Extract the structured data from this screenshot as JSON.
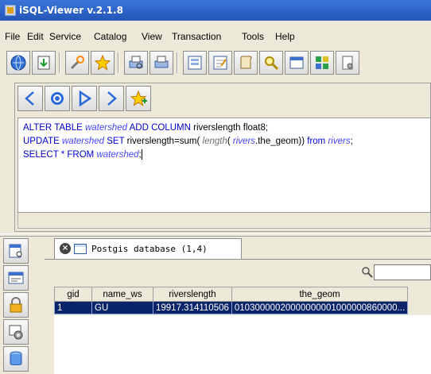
{
  "window": {
    "title": "iSQL-Viewer v.2.1.8"
  },
  "menu": [
    "File",
    "Edit",
    "Service",
    "Catalog",
    "View",
    "Transaction",
    "Tools",
    "Help"
  ],
  "editor": {
    "line1": {
      "k1": "ALTER TABLE ",
      "t1": "watershed",
      "k2": " ADD COLUMN ",
      "x1": "riverslength float8;"
    },
    "line2": {
      "k1": "UPDATE ",
      "t1": "watershed",
      "k2": " SET ",
      "x1": "riverslength=sum( ",
      "f1": "length",
      "x2": "( ",
      "t2": "rivers",
      "x3": ".the_geom)) ",
      "k3": "from ",
      "t3": "rivers",
      "x4": ";"
    },
    "line3": {
      "k1": "SELECT * FROM ",
      "t1": "watershed",
      "x1": ";"
    }
  },
  "results": {
    "tab_label": "Postgis database (1,4)",
    "tab_close": "×",
    "search_value": "",
    "columns": [
      "gid",
      "name_ws",
      "riverslength",
      "the_geom"
    ],
    "rows": [
      [
        "1",
        "GU",
        "19917.314110506",
        "01030000020000000001000000860000..."
      ]
    ]
  }
}
